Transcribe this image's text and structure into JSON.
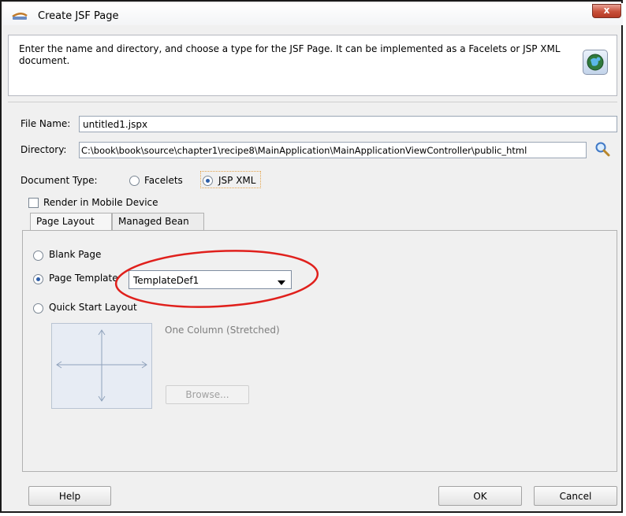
{
  "window": {
    "title": "Create JSF Page",
    "close_glyph": "x"
  },
  "header": {
    "description": "Enter the name and directory, and choose a type for the JSF Page. It can be implemented as a Facelets or JSP XML document."
  },
  "form": {
    "file_name_label": "File Name:",
    "file_name_value": "untitled1.jspx",
    "directory_label": "Directory:",
    "directory_value": "C:\\book\\book\\source\\chapter1\\recipe8\\MainApplication\\MainApplicationViewController\\public_html",
    "document_type_label": "Document Type:",
    "document_types": [
      {
        "label": "Facelets",
        "selected": false
      },
      {
        "label": "JSP XML",
        "selected": true
      }
    ],
    "render_mobile_label": "Render in Mobile Device",
    "render_mobile_checked": false
  },
  "tabs": [
    {
      "label": "Page Layout",
      "active": true
    },
    {
      "label": "Managed Bean",
      "active": false
    }
  ],
  "page_layout": {
    "options": [
      {
        "label": "Blank Page",
        "selected": false
      },
      {
        "label": "Page Template",
        "selected": true
      },
      {
        "label": "Quick Start Layout",
        "selected": false
      }
    ],
    "template_selected": "TemplateDef1",
    "layout_name": "One Column (Stretched)",
    "browse_label": "Browse..."
  },
  "buttons": {
    "help": "Help",
    "ok": "OK",
    "cancel": "Cancel"
  },
  "colors": {
    "annotation_circle": "#e0201c",
    "selected_radio": "#2d5ea8",
    "focus_outline": "#e3a34a"
  }
}
